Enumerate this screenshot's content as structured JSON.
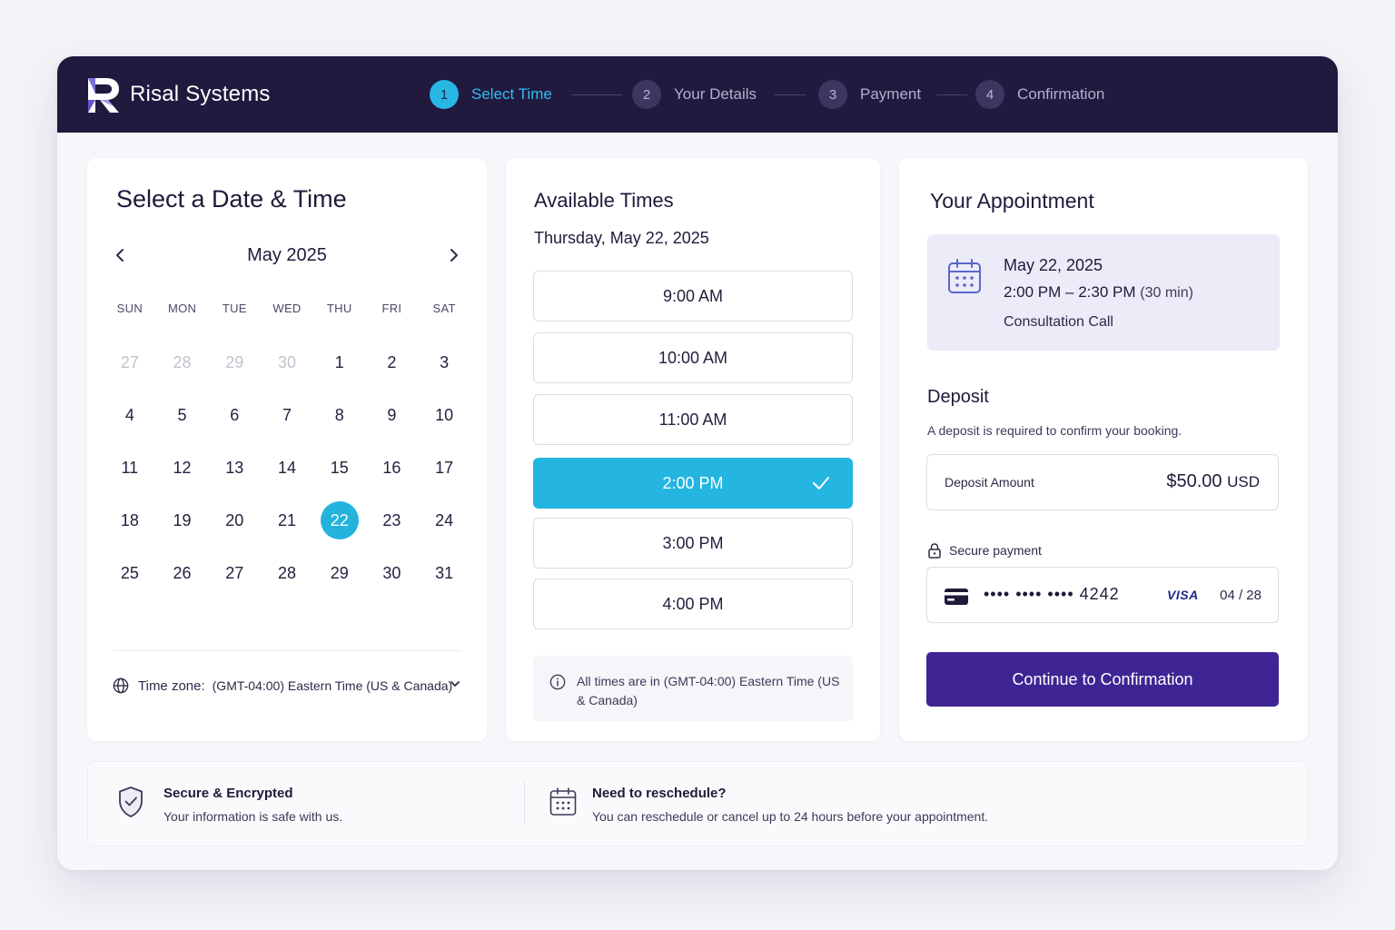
{
  "header": {
    "brand": "Risal Systems",
    "steps": [
      {
        "num": "1",
        "label": "Select Time",
        "active": true
      },
      {
        "num": "2",
        "label": "Your Details",
        "active": false
      },
      {
        "num": "3",
        "label": "Payment",
        "active": false
      },
      {
        "num": "4",
        "label": "Confirmation",
        "active": false
      }
    ]
  },
  "calendar": {
    "title": "Select a Date & Time",
    "month": "May 2025",
    "weekdays": [
      "SUN",
      "MON",
      "TUE",
      "WED",
      "THU",
      "FRI",
      "SAT"
    ],
    "days": [
      {
        "n": "27",
        "muted": true
      },
      {
        "n": "28",
        "muted": true
      },
      {
        "n": "29",
        "muted": true
      },
      {
        "n": "30",
        "muted": true
      },
      {
        "n": "1"
      },
      {
        "n": "2"
      },
      {
        "n": "3"
      },
      {
        "n": "4"
      },
      {
        "n": "5"
      },
      {
        "n": "6"
      },
      {
        "n": "7"
      },
      {
        "n": "8"
      },
      {
        "n": "9"
      },
      {
        "n": "10"
      },
      {
        "n": "11"
      },
      {
        "n": "12"
      },
      {
        "n": "13"
      },
      {
        "n": "14"
      },
      {
        "n": "15"
      },
      {
        "n": "16"
      },
      {
        "n": "17"
      },
      {
        "n": "18"
      },
      {
        "n": "19"
      },
      {
        "n": "20"
      },
      {
        "n": "21"
      },
      {
        "n": "22",
        "selected": true
      },
      {
        "n": "23"
      },
      {
        "n": "24"
      },
      {
        "n": "25"
      },
      {
        "n": "26"
      },
      {
        "n": "27"
      },
      {
        "n": "28"
      },
      {
        "n": "29"
      },
      {
        "n": "30"
      },
      {
        "n": "31"
      }
    ],
    "timezone_label": "Time zone:",
    "timezone_value": "(GMT-04:00) Eastern Time (US & Canada)"
  },
  "times": {
    "title": "Available Times",
    "date": "Thursday, May 22, 2025",
    "slots": [
      {
        "label": "9:00 AM"
      },
      {
        "label": "10:00 AM"
      },
      {
        "label": "11:00 AM"
      },
      {
        "label": "2:00 PM",
        "selected": true
      },
      {
        "label": "3:00 PM"
      },
      {
        "label": "4:00 PM"
      }
    ],
    "note": "All times are in (GMT-04:00) Eastern Time (US & Canada)"
  },
  "appointment": {
    "title": "Your Appointment",
    "date": "May 22, 2025",
    "time": "2:00 PM – 2:30 PM",
    "duration": "(30 min)",
    "type": "Consultation Call",
    "deposit_title": "Deposit",
    "deposit_desc": "A deposit is required to confirm your booking.",
    "deposit_label": "Deposit Amount",
    "deposit_amount": "$50.00",
    "deposit_currency": "USD",
    "secure_label": "Secure payment",
    "card_mask": "•••• •••• •••• 4242",
    "card_brand": "VISA",
    "card_exp": "04 / 28",
    "cta": "Continue to Confirmation"
  },
  "info": {
    "secure_title": "Secure & Encrypted",
    "secure_desc": "Your information is safe with us.",
    "reschedule_title": "Need to reschedule?",
    "reschedule_desc": "You can reschedule or cancel up to 24 hours before your appointment."
  },
  "colors": {
    "header_bg": "#22193f",
    "accent": "#24b5e0",
    "primary": "#3f2594"
  },
  "icons": [
    "logo-icon",
    "chevron-left-icon",
    "chevron-right-icon",
    "globe-icon",
    "chevron-down-icon",
    "check-icon",
    "info-icon",
    "calendar-icon",
    "lock-icon",
    "credit-card-icon",
    "shield-check-icon"
  ]
}
